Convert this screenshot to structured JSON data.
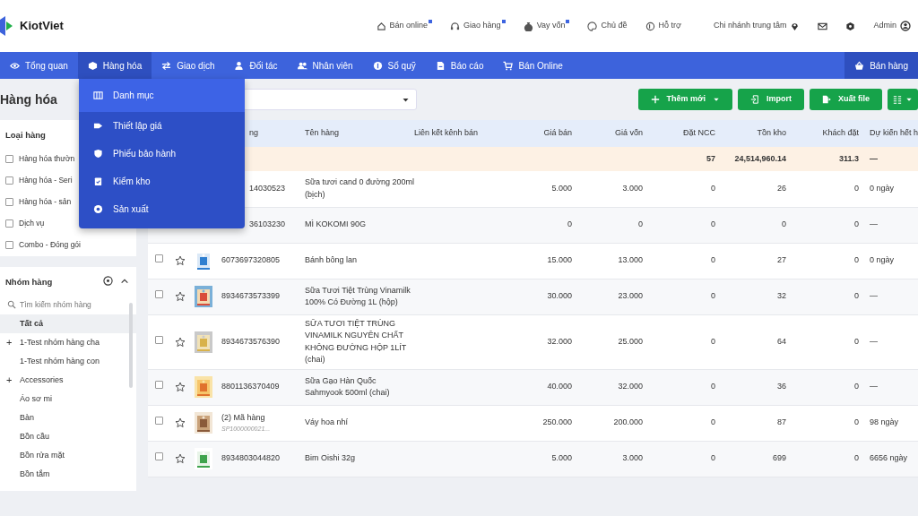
{
  "app": {
    "brand": "KiotViet"
  },
  "top_links": [
    {
      "label": "Bán online",
      "dot": true
    },
    {
      "label": "Giao hàng",
      "dot": true
    },
    {
      "label": "Vay vốn",
      "dot": true
    },
    {
      "label": "Chủ đề",
      "dot": false
    },
    {
      "label": "Hỗ trợ",
      "dot": false
    }
  ],
  "branch": "Chi nhánh trung tâm",
  "user": "Admin",
  "nav": [
    {
      "label": "Tổng quan",
      "selected": false
    },
    {
      "label": "Hàng hóa",
      "selected": true
    },
    {
      "label": "Giao dịch",
      "selected": false
    },
    {
      "label": "Đối tác",
      "selected": false
    },
    {
      "label": "Nhân viên",
      "selected": false
    },
    {
      "label": "Sổ quỹ",
      "selected": false
    },
    {
      "label": "Báo cáo",
      "selected": false
    },
    {
      "label": "Bán Online",
      "selected": false
    }
  ],
  "sell_button": "Bán hàng",
  "menu": [
    {
      "label": "Danh mục",
      "selected": true
    },
    {
      "label": "Thiết lập giá",
      "selected": false
    },
    {
      "label": "Phiếu bảo hành",
      "selected": false
    },
    {
      "label": "Kiểm kho",
      "selected": false
    },
    {
      "label": "Sản xuất",
      "selected": false
    }
  ],
  "page_title": "Hàng hóa",
  "types": {
    "title": "Loại hàng",
    "items": [
      {
        "label": "Hàng hóa thườn",
        "checked": false
      },
      {
        "label": "Hàng hóa - Seri",
        "checked": false
      },
      {
        "label": "Hàng hóa - sản",
        "checked": false
      },
      {
        "label": "Dịch vụ",
        "checked": false
      },
      {
        "label": "Combo - Đóng gói",
        "checked": false
      }
    ]
  },
  "groups": {
    "title": "Nhóm hàng",
    "placeholder": "Tìm kiếm nhóm hàng",
    "items": [
      {
        "label": "Tất cả",
        "selected": true
      },
      {
        "label": "1-Test nhóm hàng cha",
        "toggle": "+",
        "selected": false
      },
      {
        "label": "1-Test nhóm hàng con",
        "selected": false
      },
      {
        "label": "Accessories",
        "toggle": "+",
        "selected": false
      },
      {
        "label": "Áo sơ mi",
        "selected": false
      },
      {
        "label": "Bàn",
        "selected": false
      },
      {
        "label": "Bồn cầu",
        "selected": false
      },
      {
        "label": "Bồn rửa mặt",
        "selected": false
      },
      {
        "label": "Bồn tắm",
        "selected": false
      }
    ]
  },
  "toolbar": {
    "buttons": [
      {
        "label": "Thêm mới",
        "caret": true
      },
      {
        "label": "Import",
        "caret": false
      },
      {
        "label": "Xuất file",
        "caret": false
      }
    ]
  },
  "table": {
    "columns": [
      "ng",
      "Tên hàng",
      "Liên kết kênh bán",
      "Giá bán",
      "Giá vốn",
      "Đặt NCC",
      "Tồn kho",
      "Khách đặt",
      "Dự kiến hết h"
    ],
    "summary": [
      "57",
      "24,514,960.14",
      "311.3",
      "—"
    ],
    "rows": [
      {
        "covered": true,
        "code": "14030523",
        "name": "Sữa tươi cand 0 đường 200ml (bịch)",
        "price": "5.000",
        "cost": "3.000",
        "ncc": "0",
        "stock": "26",
        "customer": "0",
        "forecast": "0 ngày"
      },
      {
        "covered": true,
        "code": "36103230",
        "name": "MÌ KOKOMI 90G",
        "price": "0",
        "cost": "0",
        "ncc": "0",
        "stock": "0",
        "customer": "0",
        "forecast": "—"
      },
      {
        "covered": false,
        "checked": false,
        "code": "6073697320805",
        "name": "Bánh bông lan",
        "price": "15.000",
        "cost": "13.000",
        "ncc": "0",
        "stock": "27",
        "customer": "0",
        "forecast": "0 ngày"
      },
      {
        "covered": false,
        "checked": false,
        "code": "8934673573399",
        "name": "Sữa Tươi Tiệt Trùng Vinamilk 100% Có Đường 1L (hộp)",
        "price": "30.000",
        "cost": "23.000",
        "ncc": "0",
        "stock": "32",
        "customer": "0",
        "forecast": "—"
      },
      {
        "covered": false,
        "checked": false,
        "code": "8934673576390",
        "name": "SỮA TƯƠI TIỆT TRÙNG VINAMILK NGUYÊN CHẤT KHÔNG ĐƯỜNG HỘP 1LÍT (chai)",
        "price": "32.000",
        "cost": "25.000",
        "ncc": "0",
        "stock": "64",
        "customer": "0",
        "forecast": "—"
      },
      {
        "covered": false,
        "checked": false,
        "code": "8801136370409",
        "name": "Sữa Gạo Hàn Quốc Sahmyook 500ml (chai)",
        "price": "40.000",
        "cost": "32.000",
        "ncc": "0",
        "stock": "36",
        "customer": "0",
        "forecast": "—"
      },
      {
        "covered": false,
        "checked": false,
        "code": "(2) Mã hàng",
        "subcode": "SP1000000021...",
        "name": "Váy hoa nhí",
        "price": "250.000",
        "cost": "200.000",
        "ncc": "0",
        "stock": "87",
        "customer": "0",
        "forecast": "98 ngày"
      },
      {
        "covered": false,
        "checked": false,
        "code": "8934803044820",
        "name": "Bim Oishi 32g",
        "price": "5.000",
        "cost": "3.000",
        "ncc": "0",
        "stock": "699",
        "customer": "0",
        "forecast": "6656 ngày"
      }
    ]
  }
}
